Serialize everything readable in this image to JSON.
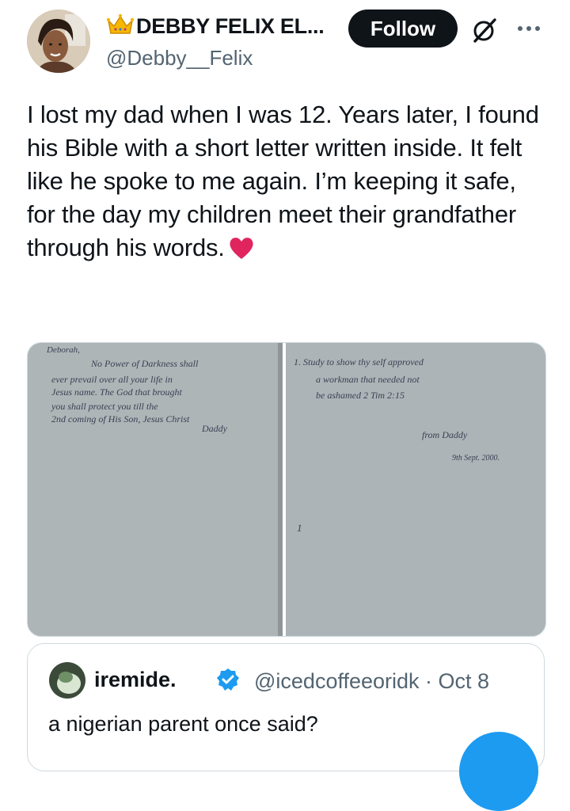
{
  "author": {
    "display_name": "DEBBY FELIX EL...",
    "handle": "@Debby__Felix",
    "avatar_icon": "profile-photo",
    "badge_icon": "crown-icon"
  },
  "actions": {
    "follow_label": "Follow",
    "grok_icon": "grok-icon",
    "more_icon": "more-options-icon"
  },
  "post": {
    "text": "I lost my dad when I was 12. Years later, I found his Bible with a short letter written inside. It felt like he spoke to me again. I’m keeping it safe, for the day my children meet their grandfather through his words.",
    "emoji": "red-heart"
  },
  "media": {
    "left_page": {
      "salutation": "Deborah,",
      "lines": [
        "No Power of Darkness shall",
        "ever prevail over all your life in",
        "Jesus name. The God that brought",
        "you shall protect you till the",
        "2nd coming of His Son, Jesus Christ",
        "Daddy"
      ]
    },
    "right_page": {
      "lines": [
        "1. Study to show thy self approved",
        "a workman that needed not",
        "be ashamed  2 Tim 2:15"
      ],
      "signature": "from Daddy",
      "date": "9th Sept. 2000.",
      "page_number": "1"
    }
  },
  "quote": {
    "name": "iremide.",
    "handle_date": "@icedcoffeeoridk · Oct 8",
    "text": "a nigerian parent once said?",
    "verified_icon": "verified-badge-icon"
  },
  "colors": {
    "text_primary": "#0f1419",
    "text_secondary": "#536471",
    "accent": "#1d9bf0",
    "follow_bg": "#0f1419",
    "border": "#cfd9de",
    "heart": "#e0245e"
  }
}
